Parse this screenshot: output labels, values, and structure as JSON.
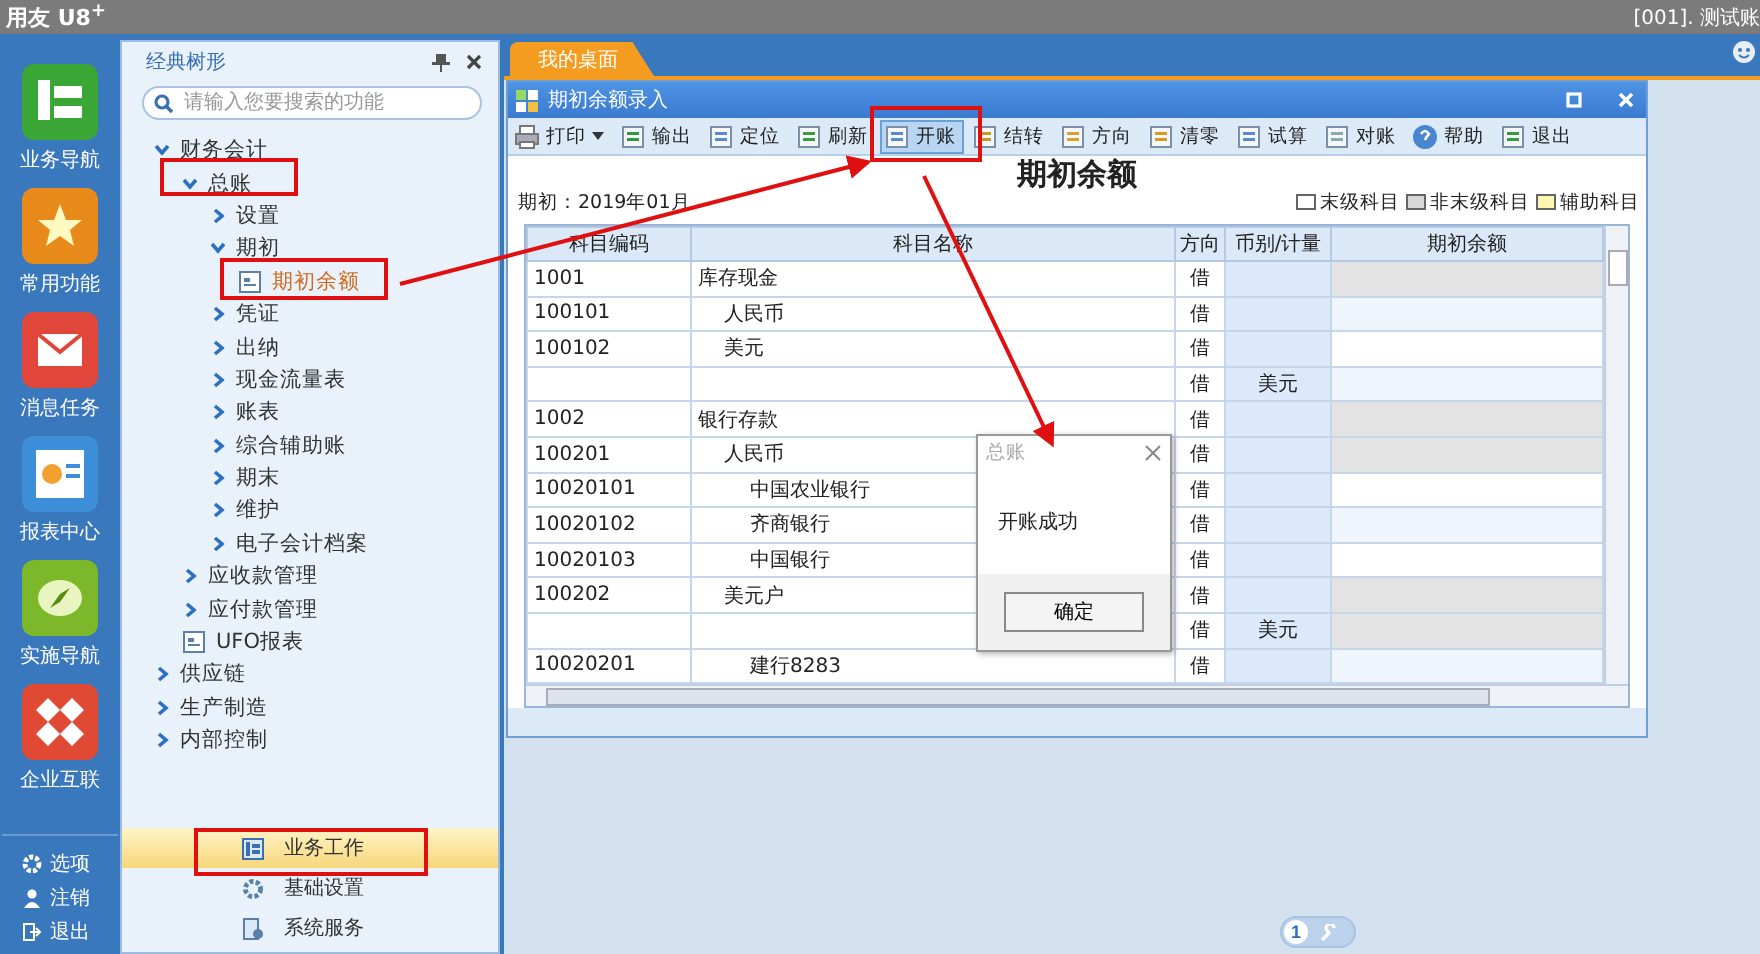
{
  "app": {
    "logo": "用友 U8",
    "logo_sup": "+",
    "account": "[001]. 测试账"
  },
  "nav": [
    {
      "label": "业务导航",
      "color": "#3aa635"
    },
    {
      "label": "常用功能",
      "color": "#e88a1a"
    },
    {
      "label": "消息任务",
      "color": "#e0463a"
    },
    {
      "label": "报表中心",
      "color": "#3c8fd8"
    },
    {
      "label": "实施导航",
      "color": "#7cb82a"
    },
    {
      "label": "企业互联",
      "color": "#e04a35"
    }
  ],
  "nav_bottom": [
    "选项",
    "注销",
    "退出"
  ],
  "tree_panel": {
    "title": "经典树形",
    "search": {
      "placeholder": "请输入您要搜索的功能"
    },
    "items": [
      {
        "label": "财务会计",
        "kind": "folder",
        "expanded": true,
        "selected": false,
        "children": [
          {
            "label": "总账",
            "kind": "folder",
            "expanded": true,
            "selected": false,
            "children": [
              {
                "label": "设置",
                "kind": "folder",
                "expanded": false,
                "selected": false
              },
              {
                "label": "期初",
                "kind": "folder",
                "expanded": true,
                "selected": false,
                "children": [
                  {
                    "label": "期初余额",
                    "kind": "page",
                    "selected": true
                  }
                ]
              },
              {
                "label": "凭证",
                "kind": "folder",
                "expanded": false,
                "selected": false
              },
              {
                "label": "出纳",
                "kind": "folder",
                "expanded": false,
                "selected": false
              },
              {
                "label": "现金流量表",
                "kind": "folder",
                "expanded": false,
                "selected": false
              },
              {
                "label": "账表",
                "kind": "folder",
                "expanded": false,
                "selected": false
              },
              {
                "label": "综合辅助账",
                "kind": "folder",
                "expanded": false,
                "selected": false
              },
              {
                "label": "期末",
                "kind": "folder",
                "expanded": false,
                "selected": false
              },
              {
                "label": "维护",
                "kind": "folder",
                "expanded": false,
                "selected": false
              },
              {
                "label": "电子会计档案",
                "kind": "folder",
                "expanded": false,
                "selected": false
              }
            ]
          },
          {
            "label": "应收款管理",
            "kind": "folder",
            "expanded": false,
            "selected": false
          },
          {
            "label": "应付款管理",
            "kind": "folder",
            "expanded": false,
            "selected": false
          },
          {
            "label": "UFO报表",
            "kind": "page",
            "selected": false
          }
        ]
      },
      {
        "label": "供应链",
        "kind": "folder",
        "expanded": false,
        "selected": false
      },
      {
        "label": "生产制造",
        "kind": "folder",
        "expanded": false,
        "selected": false
      },
      {
        "label": "内部控制",
        "kind": "folder",
        "expanded": false,
        "selected": false
      }
    ],
    "sections": [
      {
        "label": "业务工作",
        "selected": true
      },
      {
        "label": "基础设置",
        "selected": false
      },
      {
        "label": "系统服务",
        "selected": false
      }
    ]
  },
  "tabs": [
    {
      "label": "我的桌面",
      "selected": true
    }
  ],
  "window": {
    "title": "期初余额录入",
    "toolbar": [
      {
        "label": "打印",
        "dropdown": true,
        "pressed": false
      },
      {
        "label": "输出",
        "pressed": false
      },
      {
        "label": "定位",
        "pressed": false
      },
      {
        "label": "刷新",
        "pressed": false
      },
      {
        "label": "开账",
        "pressed": true
      },
      {
        "label": "结转",
        "pressed": false
      },
      {
        "label": "方向",
        "pressed": false
      },
      {
        "label": "清零",
        "pressed": false
      },
      {
        "label": "试算",
        "pressed": false
      },
      {
        "label": "对账",
        "pressed": false
      },
      {
        "label": "帮助",
        "pressed": false
      },
      {
        "label": "退出",
        "pressed": false
      }
    ],
    "heading": "期初余额",
    "period": "期初：2019年01月",
    "legend": [
      {
        "label": "末级科目",
        "color": "#ffffff"
      },
      {
        "label": "非末级科目",
        "color": "#d8d8d8"
      },
      {
        "label": "辅助科目",
        "color": "#fff6b0"
      }
    ],
    "table": {
      "columns": [
        "科目编码",
        "科目名称",
        "方向",
        "币别/计量",
        "期初余额"
      ],
      "rows": [
        {
          "code": "1001",
          "name": "库存现金",
          "direction": "借",
          "kind": "summary",
          "children": [
            {
              "code": "100101",
              "name": "人民币",
              "direction": "借",
              "kind": "detail"
            },
            {
              "code": "100102",
              "name": "美元",
              "direction": "借",
              "kind": "detail"
            },
            {
              "direction": "借",
              "currency": "美元",
              "kind": "detail"
            }
          ]
        },
        {
          "code": "1002",
          "name": "银行存款",
          "direction": "借",
          "kind": "summary",
          "children": [
            {
              "code": "100201",
              "name": "人民币",
              "direction": "借",
              "kind": "summary",
              "children": [
                {
                  "code": "10020101",
                  "name": "中国农业银行",
                  "direction": "借",
                  "kind": "detail"
                },
                {
                  "code": "10020102",
                  "name": "齐商银行",
                  "direction": "借",
                  "kind": "detail"
                },
                {
                  "code": "10020103",
                  "name": "中国银行",
                  "direction": "借",
                  "kind": "detail"
                }
              ]
            },
            {
              "code": "100202",
              "name": "美元户",
              "direction": "借",
              "kind": "summary",
              "children": [
                {
                  "direction": "借",
                  "currency": "美元",
                  "kind": "summary"
                },
                {
                  "code": "10020201",
                  "name": "建行8283",
                  "direction": "借",
                  "kind": "detail"
                }
              ]
            }
          ]
        }
      ]
    }
  },
  "dialog": {
    "title": "总账",
    "message": "开账成功",
    "button": "确定"
  },
  "pager": {
    "page": "1"
  }
}
